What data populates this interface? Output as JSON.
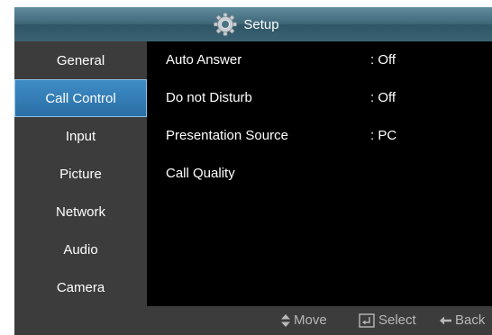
{
  "header": {
    "title": "Setup",
    "icon": "gear-icon"
  },
  "sidebar": {
    "selected_index": 1,
    "items": [
      {
        "label": "General"
      },
      {
        "label": "Call Control"
      },
      {
        "label": "Input"
      },
      {
        "label": "Picture"
      },
      {
        "label": "Network"
      },
      {
        "label": "Audio"
      },
      {
        "label": "Camera"
      }
    ]
  },
  "settings": [
    {
      "label": "Auto Answer",
      "value": ": Off"
    },
    {
      "label": "Do not Disturb",
      "value": ": Off"
    },
    {
      "label": "Presentation Source",
      "value": ": PC"
    },
    {
      "label": "Call Quality",
      "value": ""
    }
  ],
  "footer": {
    "move": {
      "label": "Move",
      "icon": "up-down-arrows-icon"
    },
    "select": {
      "label": "Select",
      "icon": "enter-icon"
    },
    "back": {
      "label": "Back",
      "icon": "left-arrow-icon"
    }
  },
  "colors": {
    "selected_accent": "#2a7ab8",
    "panel": "#3c3c3c",
    "background": "#000000"
  }
}
